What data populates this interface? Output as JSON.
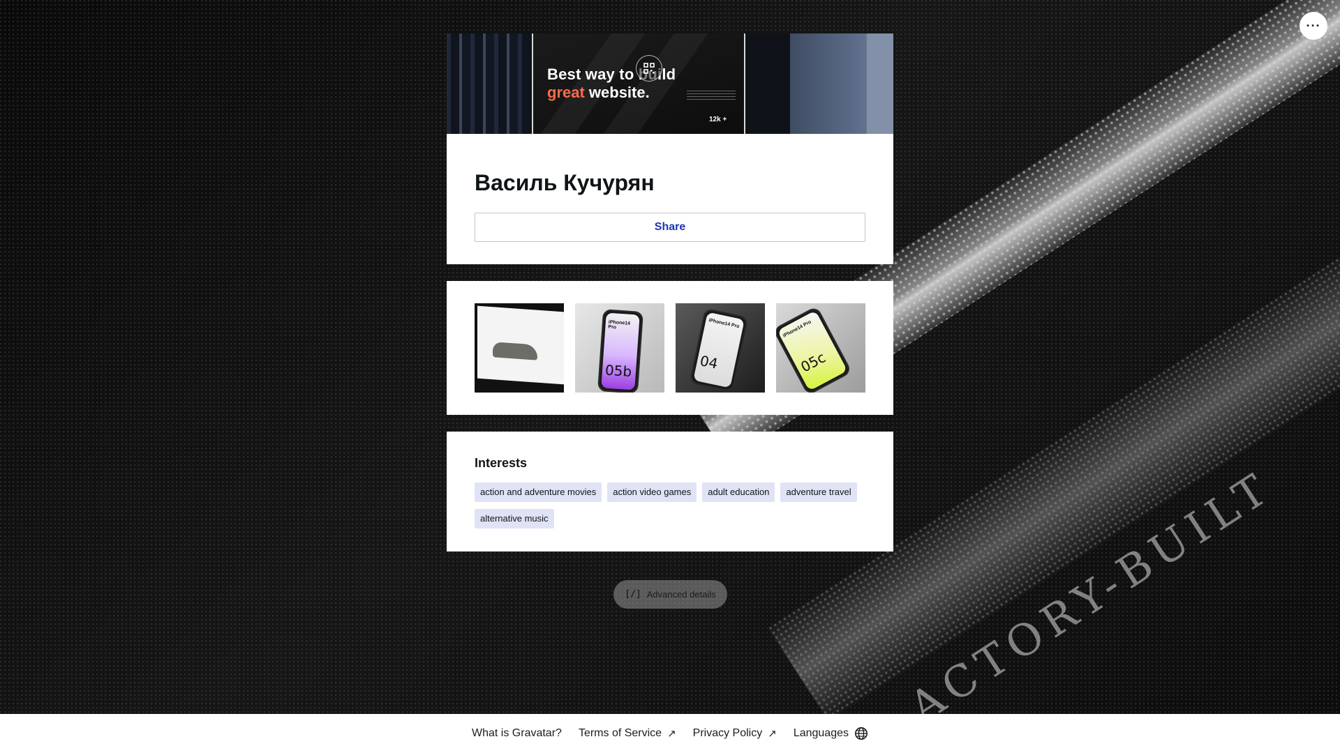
{
  "menu": {
    "label": "···"
  },
  "profile": {
    "name": "Василь Кучурян",
    "share_label": "Share",
    "header_image": {
      "line1": "Best way to build",
      "line2_accent": "great",
      "line2_rest": " website.",
      "stat": "12k +"
    }
  },
  "gallery": {
    "items": [
      {
        "name": "gallery-photo-car-site",
        "label": ""
      },
      {
        "name": "gallery-photo-iphone-05b",
        "number": "05b",
        "model": "iPhone14 Pro"
      },
      {
        "name": "gallery-photo-iphone-04",
        "number": "04",
        "model": "iPhone14 Pro"
      },
      {
        "name": "gallery-photo-iphone-05c",
        "number": "05c",
        "model": "iPhone14 Pro"
      }
    ]
  },
  "interests": {
    "title": "Interests",
    "tags": [
      "action and adventure movies",
      "action video games",
      "adult education",
      "adventure travel",
      "alternative music"
    ]
  },
  "advanced": {
    "label": "Advanced details",
    "icon": "[/]"
  },
  "footer": {
    "what_is": "What is Gravatar?",
    "terms": "Terms of Service",
    "privacy": "Privacy Policy",
    "languages": "Languages",
    "arrow": "↗"
  },
  "background": {
    "emboss_text": "ACTORY-BUILT"
  },
  "colors": {
    "accent": "#1d35b4",
    "tag_bg": "#e0e3f5",
    "hero_accent": "#ff6a4a"
  }
}
